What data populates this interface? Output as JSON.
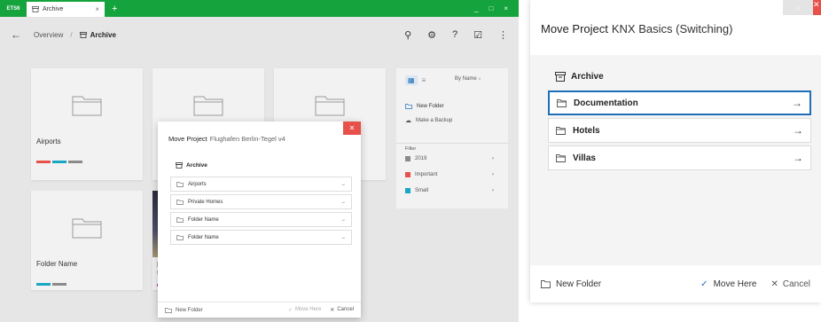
{
  "left_app": {
    "logo": "ETS6",
    "tab_label": "Archive",
    "tab_close": "×",
    "add_tab": "+",
    "window_buttons": [
      "_",
      "□",
      "×"
    ],
    "breadcrumb": {
      "root": "Overview",
      "current": "Archive"
    },
    "cards": [
      {
        "name": "Airports",
        "bar_colors": [
          "#e8504a",
          "#19a7c4",
          "#8a8a8a"
        ]
      },
      {
        "name": "P"
      },
      {
        "name": ""
      },
      {
        "name": "Folder Name",
        "bar_colors": [
          "#19a7c4",
          "#8a8a8a"
        ]
      },
      {
        "name": "F",
        "sub": "Dr"
      }
    ],
    "side_panel": {
      "sort_label": "By Name ↓",
      "new_folder": "New Folder",
      "backup": "Make a Backup",
      "filter_label": "Filter",
      "filters": [
        {
          "label": "2019",
          "color": "#8a8a8a"
        },
        {
          "label": "Important",
          "color": "#e8504a"
        },
        {
          "label": "Small",
          "color": "#19a7c4"
        }
      ]
    },
    "dialog": {
      "title": "Move Project",
      "subtitle": "Flughafen Berlin-Tegel v4",
      "root": "Archive",
      "items": [
        "Airports",
        "Private Homes",
        "Folder Name",
        "Folder Name"
      ],
      "new_folder": "New Folder",
      "move_here": "Move Here",
      "cancel": "Cancel"
    }
  },
  "right_dialog": {
    "title": "Move Project",
    "subtitle": "KNX Basics (Switching)",
    "root": "Archive",
    "items": [
      {
        "label": "Documentation",
        "selected": true
      },
      {
        "label": "Hotels",
        "selected": false
      },
      {
        "label": "Villas",
        "selected": false
      }
    ],
    "new_folder": "New Folder",
    "move_here": "Move Here",
    "cancel": "Cancel",
    "accent": "#1f6fb8"
  }
}
